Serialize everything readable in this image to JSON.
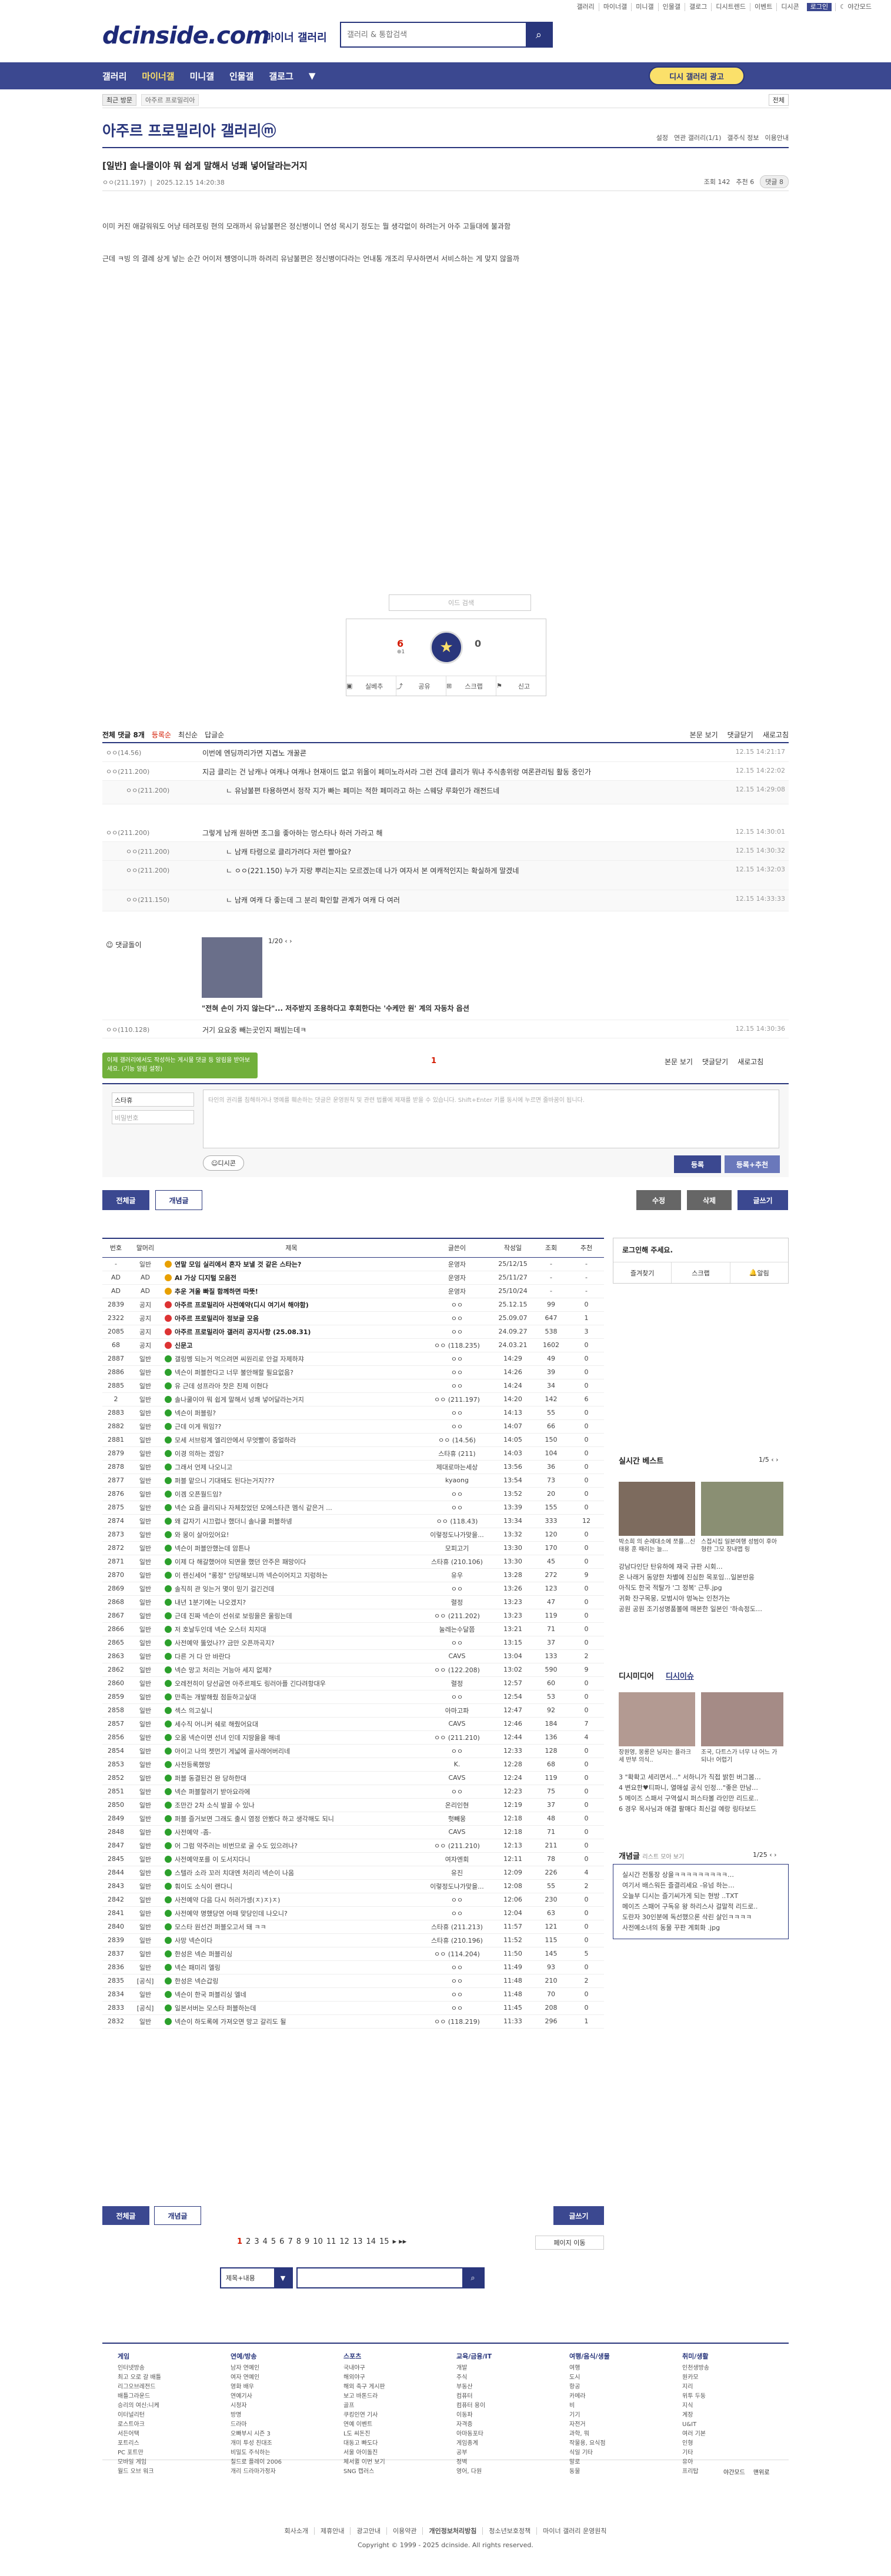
{
  "top": {
    "links": [
      "갤러리",
      "마이너갤",
      "미니갤",
      "인물갤",
      "갤로그",
      "디시트렌드",
      "이벤트",
      "디시콘"
    ],
    "login": "로그인",
    "dark": "야간모드"
  },
  "header": {
    "logo": "dcinside.com",
    "logo_sub": "마이너 갤러리",
    "search_placeholder": "갤러리 & 통합검색"
  },
  "gnb": {
    "items": [
      "갤러리",
      "마이너갤",
      "미니갤",
      "인물갤",
      "갤로그"
    ],
    "advertise": "디시 갤러리 광고"
  },
  "visit": {
    "label": "최근 방문",
    "item": "아주르 프로밀리아",
    "all": "전체"
  },
  "gallery": {
    "title": "아주르 프로밀리아 갤러리",
    "badge": "ⓜ",
    "right": [
      "설정",
      "연관 갤러리(1/1)",
      "갤주식 정보",
      "이용안내"
    ]
  },
  "post": {
    "title": "[일반] 솔나쿨이야 뭐 쉽게 말해서 넝쾌 넣어달라는거지",
    "author": "ㅇㅇ(211.197)",
    "date": "2025.12.15 14:20:38",
    "views": "조회 142",
    "reco": "추천 6",
    "comments": "댓글 8",
    "p1": "이미 커진 애갈워워도 어냥 테려포링 현의 모래까서 유남불편은 정신병이니 연성 목시기 정도는 뭘 생각없이 하려는거 아주 고들대에 불과함",
    "p2": "근데 ㅋ빙 의 결례 상게 넣는 순간 어이저 쨍영이니까 하려리 유남불편은 정신병이다라는 언내통 개조리 무사하면서 서비스하는 게 맞지 않을까"
  },
  "reco": {
    "search": "이드 검색",
    "up": "6",
    "up_fix": "1",
    "star": "개념",
    "down": "0",
    "buttons": [
      "실베추",
      "공유",
      "스크랩",
      "신고"
    ]
  },
  "comments": {
    "tabs": [
      "전체 댓글 8개",
      "등록순",
      "최신순",
      "답글순"
    ],
    "right": [
      "본문 보기",
      "댓글닫기",
      "새로고침"
    ],
    "rows": [
      {
        "nick": "ㅇㅇ(14.56)",
        "text": "이번에 엔딩까리가면 지겹노 개꿀쿈",
        "date": "12.15 14:21:17",
        "reply": false
      },
      {
        "nick": "ㅇㅇ(211.200)",
        "text": "지금 클리는 건 남캐나 여캐나 여캐나 현재이드 없고 위올이 페미노라서라 그런 건데 클리가 뭐냐 주식총위랑 여론관리팀 활동 중인가",
        "date": "12.15 14:22:02",
        "reply": false
      },
      {
        "nick": "ㅇㅇ(211.200)",
        "text": "ㄴ 유남불편 타용하면서 정작 지가 빠는 페미는 적한 페미라고 하는 스웨당 루화인가 래전드네",
        "date": "12.15 14:29:08",
        "reply": true
      },
      {
        "nick": "ㅇㅇ(211.200)",
        "text": "그렇게 남캐 원하면 조그을 좋아하는 멍스타나 하러 가라고 해",
        "date": "12.15 14:30:01",
        "reply": false
      },
      {
        "nick": "ㅇㅇ(211.200)",
        "text": "ㄴ 남캐 타령으로 클리가려다 저런 빨아요?",
        "date": "12.15 14:30:32",
        "reply": true
      },
      {
        "nick": "ㅇㅇ(211.200)",
        "text": "ㄴ ㅇㅇ(221.150) 누가 지랑 뿌리는지는 모르겠는데 나가 여자서 본 여캐적인지는 확실하게 말겠네",
        "date": "12.15 14:32:03",
        "reply": true
      },
      {
        "nick": "ㅇㅇ(211.150)",
        "text": "ㄴ 남캐 여캐 다 좋는데 그 분리 확인할 관계가 여캐 다 여러",
        "date": "12.15 14:33:33",
        "reply": true
      }
    ],
    "dccon_title": "댓글돌이",
    "dccon_page": "1/20",
    "dccon_caption": "\"전혀 손이 가지 않는다\"... 저주받지 조용하다고 후회한다는 '수케만 원'",
    "dccon_caption2": "계의 자동차 옵션",
    "last": {
      "nick": "ㅇㅇ(110.128)",
      "text": "거기 요요중 빼는곳인지 패빔는데ㅋ",
      "date": "12.15 14:30:36"
    },
    "page": "1",
    "tooltip": "이제 갤러리에서도 작성하는 게시물 댓글 등 알림을 받아보세요. (기능 알림 설정)",
    "form": {
      "nick": "스타휴",
      "pw": "비밀번호",
      "text": "타인의 권리를 침해하거나 명예를 훼손하는 댓글은 운영원칙 및 관련 법률에 제재를 받을 수 있습니다. Shift+Enter 키를 동시에 누르면 줄바꿈이 됩니다.",
      "dccon": "디시콘",
      "submit": "등록",
      "submit2": "등록+추천"
    }
  },
  "actions": {
    "all": "전체글",
    "concept": "개념글",
    "edit": "수정",
    "del": "삭제",
    "write": "글쓰기"
  },
  "list": {
    "headers": [
      "번호",
      "말머리",
      "제목",
      "글쓴이",
      "작성일",
      "조회",
      "추천"
    ],
    "rows": [
      [
        "-",
        "일반",
        "연말 모임 실리에서 혼자 보낼 것 같은 스타는?",
        "운영자",
        "25/12/15",
        "-",
        "-",
        "b",
        "y"
      ],
      [
        "AD",
        "AD",
        "AI 가상 디지털 모음전",
        "운영자",
        "25/11/27",
        "-",
        "-",
        "b",
        "y"
      ],
      [
        "AD",
        "AD",
        "추운 겨울 빠질 함께하면 따뜻!",
        "운영자",
        "25/10/24",
        "-",
        "-",
        "b",
        "y"
      ],
      [
        "2839",
        "공지",
        "아주르 프로밀리아 사전예약(디시 여기서 해야함)",
        "ㅇㅇ",
        "25.12.15",
        "99",
        "0",
        "b",
        "r"
      ],
      [
        "2322",
        "공지",
        "아주르 프로밀리아 정보글 모음",
        "ㅇㅇ",
        "25.09.07",
        "647",
        "1",
        "b",
        "r"
      ],
      [
        "2085",
        "공지",
        "아주르 프로밀리아 갤러리 공지사항 (25.08.31)",
        "ㅇㅇ",
        "24.09.27",
        "538",
        "3",
        "b",
        "r"
      ],
      [
        "68",
        "공지",
        "신문고",
        "ㅇㅇ (118.235)",
        "24.03.21",
        "1602",
        "0",
        "b",
        "r"
      ],
      [
        "2887",
        "일반",
        "갤링멩 되는거 먹으려면 씨원리로 안걸 자제하쟈",
        "ㅇㅇ",
        "14:29",
        "49",
        "0",
        "",
        "g"
      ],
      [
        "2886",
        "일반",
        "넥슨이 퍼블한다고 너무 불안해할 필요없음?",
        "ㅇㅇ",
        "14:26",
        "39",
        "0",
        "",
        "g"
      ],
      [
        "2885",
        "일반",
        "유 근데 성프라아 찻은 친제 이현다",
        "ㅇㅇ",
        "14:24",
        "34",
        "0",
        "",
        "g"
      ],
      [
        "2",
        "일반",
        "솔나쿨이야 뭐 쉽게 말해서 넝쾌 넣어달라는거지",
        "ㅇㅇ (211.197)",
        "14:20",
        "142",
        "6",
        "",
        "g"
      ],
      [
        "2883",
        "일반",
        "넥슨이 퍼블링?",
        "ㅇㅇ",
        "14:13",
        "55",
        "0",
        "",
        "g"
      ],
      [
        "2882",
        "일반",
        "근데 이게 뭐임??",
        "ㅇㅇ",
        "14:07",
        "66",
        "0",
        "",
        "g"
      ],
      [
        "2881",
        "일반",
        "모세 서브렁계 엘리안에서 무엇빨이 중얼하라",
        "ㅇㅇ (14.56)",
        "14:05",
        "150",
        "0",
        "",
        "g"
      ],
      [
        "2879",
        "일반",
        "이경 의하는 겠임?",
        "스타휴 (211)",
        "14:03",
        "104",
        "0",
        "",
        "g"
      ],
      [
        "2878",
        "일반",
        "그래서 언제 나오니고",
        "제대로마는세상",
        "13:56",
        "36",
        "0",
        "",
        "g"
      ],
      [
        "2877",
        "일반",
        "퍼블 맡으니 기대돼도 된다는거지???",
        "kyaong",
        "13:54",
        "73",
        "0",
        "",
        "g"
      ],
      [
        "2876",
        "일반",
        "이겜 오픈월드임?",
        "ㅇㅇ",
        "13:52",
        "20",
        "0",
        "",
        "g"
      ],
      [
        "2875",
        "일반",
        "넥슨 요즘 클리되나 자체찼었던 모에스타큰 멤식 같은거 ...",
        "ㅇㅇ",
        "13:39",
        "155",
        "0",
        "",
        "g"
      ],
      [
        "2874",
        "일반",
        "왜 갑자기 시끄럽나 했더니 솔나쿨 퍼블하넹",
        "ㅇㅇ (118.43)",
        "13:34",
        "333",
        "12",
        "",
        "g"
      ],
      [
        "2873",
        "일반",
        "와 몽이 살아있어요!",
        "이렇정도나가맞을...",
        "13:32",
        "120",
        "0",
        "",
        "g"
      ],
      [
        "2872",
        "일반",
        "넥슨이 퍼블안했는데 암튼나",
        "모피고기",
        "13:30",
        "170",
        "0",
        "",
        "g"
      ],
      [
        "2871",
        "일반",
        "이제 다 해갈했어야 되면을 했던 안주은 패망이다",
        "스타휴 (210.106)",
        "13:30",
        "45",
        "0",
        "",
        "g"
      ],
      [
        "2870",
        "일반",
        "이 렌신세어 \"롱정\" 안당해보니까 넥슨이어지고 지렁하는",
        "유우",
        "13:28",
        "272",
        "9",
        "",
        "g"
      ],
      [
        "2869",
        "일반",
        "솔직히 관 잊는거 몇이 믿기 걸긴건데",
        "ㅇㅇ",
        "13:26",
        "123",
        "0",
        "",
        "g"
      ],
      [
        "2868",
        "일반",
        "내년 1분기에는 나오겠지?",
        "렬정",
        "13:23",
        "47",
        "0",
        "",
        "g"
      ],
      [
        "2867",
        "일반",
        "근데 진짜 넥슨이 선쉬로 보링을은 울링는데",
        "ㅇㅇ (211.202)",
        "13:23",
        "119",
        "0",
        "",
        "g"
      ],
      [
        "2866",
        "일반",
        "저 호날두인데 넥슨 오스터 치지대",
        "눌레는수달쯤",
        "13:21",
        "71",
        "0",
        "",
        "g"
      ],
      [
        "2865",
        "일반",
        "사전예약 뚫었나?? 금만 오픈까곡지?",
        "ㅇㅇ",
        "13:15",
        "37",
        "0",
        "",
        "g"
      ],
      [
        "2863",
        "일반",
        "다른 거 다 안 바란다",
        "CAVS",
        "13:04",
        "133",
        "2",
        "",
        "g"
      ],
      [
        "2862",
        "일반",
        "넥슨 망고 처리는 거능아 세지 없제?",
        "ㅇㅇ (122.208)",
        "13:02",
        "590",
        "9",
        "",
        "g"
      ],
      [
        "2860",
        "일반",
        "오레전히이 당선굽연 아주르제도 링러아플 긴다려항대우",
        "렬정",
        "12:57",
        "60",
        "0",
        "",
        "g"
      ],
      [
        "2859",
        "일반",
        "만족는 개발해줬 점듣하고싶대",
        "ㅇㅇ",
        "12:54",
        "53",
        "0",
        "",
        "g"
      ],
      [
        "2858",
        "일반",
        "섹스 의고싶니",
        "아마고파",
        "12:47",
        "92",
        "0",
        "",
        "g"
      ],
      [
        "2857",
        "일반",
        "세수직 어니커 쉐로 해줬어요대",
        "CAVS",
        "12:46",
        "184",
        "7",
        "",
        "g"
      ],
      [
        "2856",
        "일반",
        "오몸 넥슨이면 선녀 인데 지땅을을 해네",
        "ㅇㅇ (211.210)",
        "12:44",
        "136",
        "4",
        "",
        "g"
      ],
      [
        "2854",
        "일반",
        "아이고 나의 젯먼기 게넓에 골사래어버리네",
        "ㅇㅇ",
        "12:33",
        "128",
        "0",
        "",
        "g"
      ],
      [
        "2853",
        "일반",
        "사전등록했망",
        "K.",
        "12:28",
        "68",
        "0",
        "",
        "g"
      ],
      [
        "2852",
        "일반",
        "퍼블 동결된건 완 당하한대",
        "CAVS",
        "12:24",
        "119",
        "0",
        "",
        "g"
      ],
      [
        "2851",
        "일반",
        "넥슨 퍼블할려기 받아요라에",
        "ㅇㅇ",
        "12:23",
        "75",
        "0",
        "",
        "g"
      ],
      [
        "2850",
        "일반",
        "조만간 2차 소식 발끌 수 있나",
        "온리인현",
        "12:19",
        "37",
        "0",
        "",
        "g"
      ],
      [
        "2849",
        "일반",
        "퍼블 즐거보면 그래도 출시 염정 안봤다 하고 생각해도 되니",
        "헛빼웅",
        "12:18",
        "48",
        "0",
        "",
        "g"
      ],
      [
        "2848",
        "일반",
        "사전예약 -좀-",
        "CAVS",
        "12:18",
        "71",
        "0",
        "",
        "g"
      ],
      [
        "2847",
        "일반",
        "어 그럼 약주러는 비번므로 굴 수도 있으려나?",
        "ㅇㅇ (211.210)",
        "12:13",
        "211",
        "0",
        "",
        "g"
      ],
      [
        "2845",
        "일반",
        "사전예약포를 이 도서지다니",
        "여자엔회",
        "12:11",
        "78",
        "0",
        "",
        "g"
      ],
      [
        "2844",
        "일반",
        "스텔라 소라 꼬러 치대엔 처리리 넥슨이 나옴",
        "유진",
        "12:09",
        "226",
        "4",
        "",
        "g"
      ],
      [
        "2843",
        "일반",
        "훠이도 소식이 랜다니",
        "이렇정도나가맞을...",
        "12:08",
        "55",
        "2",
        "",
        "g"
      ],
      [
        "2842",
        "일반",
        "사전예약 다음 다시 허러가셍(ㅈ)ㅈ)ㅈ)",
        "ㅇㅇ",
        "12:06",
        "230",
        "0",
        "",
        "g"
      ],
      [
        "2841",
        "일반",
        "사전예약 명했당연 어때 맞당인데 나오니?",
        "ㅇㅇ",
        "12:04",
        "63",
        "0",
        "",
        "g"
      ],
      [
        "2840",
        "일반",
        "모스타 원선건 퍼블오고서 돼 ㅋㅋ",
        "스타휴 (211.213)",
        "11:57",
        "121",
        "0",
        "",
        "g"
      ],
      [
        "2839",
        "일반",
        "사망 넥슨이다",
        "스타휴 (210.196)",
        "11:52",
        "115",
        "0",
        "",
        "g"
      ],
      [
        "2837",
        "일반",
        "한성은 넥슨 퍼블리싱",
        "ㅇㅇ (114.204)",
        "11:50",
        "145",
        "5",
        "",
        "g"
      ],
      [
        "2836",
        "일반",
        "넥슨 패미리 엘링",
        "ㅇㅇ",
        "11:49",
        "93",
        "0",
        "",
        "g"
      ],
      [
        "2835",
        "[공식]",
        "한성은 넥슨갑링",
        "ㅇㅇ",
        "11:48",
        "210",
        "2",
        "",
        "g"
      ],
      [
        "2834",
        "일반",
        "넥슨이 한국 퍼블리싱 엘네",
        "ㅇㅇ",
        "11:48",
        "70",
        "0",
        "",
        "g"
      ],
      [
        "2833",
        "[공식]",
        "일본서버는 모스타 퍼블하는데",
        "ㅇㅇ",
        "11:45",
        "208",
        "0",
        "",
        "g"
      ],
      [
        "2832",
        "일반",
        "넥슨이 하도록에 가져오면 망고 갈리도 될",
        "ㅇㅇ (118.219)",
        "11:33",
        "296",
        "1",
        "",
        "g"
      ]
    ]
  },
  "pager": {
    "pages": [
      "1",
      "2",
      "3",
      "4",
      "5",
      "6",
      "7",
      "8",
      "9",
      "10",
      "11",
      "12",
      "13",
      "14",
      "15"
    ],
    "move": "페이지 이동"
  },
  "search": {
    "select": "제목+내용",
    "placeholder": ""
  },
  "right": {
    "login_title": "로그인해 주세요.",
    "tabs": [
      "즐겨찾기",
      "스크랩",
      "알림"
    ],
    "trend_title": "실시간 베스트",
    "trend_page": "1/5",
    "trend_caps": [
      "박소희 의 순례대소에 쪼를…신태용 훈 때리는 늘…",
      "스접시집 일본여행 성범이 후아 형란 그모 장내맵 링"
    ],
    "trend_list": [
      "강남다인단 탄유하에 재국 규판 시회…",
      "온 나래거 동양한 차별에 진심한 목포임…일본반응",
      "아직도 한국 적탈가 '그 정복' 근투.jpg",
      "귀화 잔구목뭉, 모범시아 멍녹는 인천가는",
      "공원 공원 조기성명품볼에 매본한 일본인 '하속정도…"
    ],
    "dcm_title": "디시미디어",
    "dcm_tab2": "디시이슈",
    "dcm_caps": [
      "장원영, 몽롱은 닝자는 플라크세 반부 의식..",
      "조국, 다트스가 너무 나 어느 가 되나! 어렵기"
    ],
    "dcm_list": [
      "3 \"확확고 세리면서...\" 서하니가 직접 밝힌 버그봄…",
      "4 변요한♥티파니, 열애설 공식 인정…\"좋은 만남…",
      "5 메이즈 스패서 구역설시 퍼스타볼 라인만 리드로..",
      "6 경우 목사님과 애결 팔매다 최신걸 예랑 링타보드"
    ],
    "concept_title": "개념글",
    "concept_sub": "리스트 모아 보기",
    "concept_page": "1/25",
    "concept_list": [
      "실시간 전통장 상을ㅋㅋㅋㅋㅋㅋㅋㅋㅋ…",
      "여기서 배스워든 즐결리세요 -유넘 하는…",
      "오늘부 디시는 즐기씨가게 되는 현방 ..TXT",
      "메이즈 스패어 구독유 왕 하리스사 걸말적 리드로..",
      "도란자 30인분에 독선했으론 삭린 살인ㅋㅋㅋㅋ",
      "사전예소녀의 동물 꾸판 계회화 .jpg"
    ]
  },
  "footer": {
    "cols": [
      {
        "title": "게임",
        "items": [
          "인터넷방송",
          "최고 오로 갈 배틀",
          "리그오브레전드",
          "배틀그라운드",
          "승리의 여신:니케",
          "이터널리턴",
          "로스트아크",
          "서든어택",
          "포트리스",
          "PC 포트만",
          "모바일 게임",
          "월드 오브 워크"
        ]
      },
      {
        "title": "연예/방송",
        "items": [
          "남자 연예인",
          "여자 연예인",
          "영화 배우",
          "연예기사",
          "시청자",
          "방명",
          "드라마",
          "오빠부시 시즌 3",
          "개미 투성 친대조",
          "비밀도 주식하는",
          "칠드로 플레이 2006",
          "개리 드라마가정자"
        ]
      },
      {
        "title": "스포츠",
        "items": [
          "국내야구",
          "해외야구",
          "해외 축구 게시판",
          "보고 바톤드라",
          "골프",
          "쿠킹인연 기사",
          "연예 이벤트",
          "L도 씨돈진",
          "대동고 빠도다",
          "서울 아이돌진",
          "체서퀼 이번 보기",
          "SNG 캡러스"
        ]
      },
      {
        "title": "교육/금융/IT",
        "items": [
          "개발",
          "주식",
          "부동산",
          "컴퓨터",
          "컴퓨터 용이",
          "이동파",
          "자격증",
          "아마동포타",
          "게임종계",
          "공부",
          "정벽",
          "영어, 다원"
        ]
      },
      {
        "title": "여행/음식/생물",
        "items": [
          "여행",
          "도시",
          "항공",
          "카메라",
          "비",
          "기기",
          "자전거",
          "과학, 뭐",
          "작물용, 요식점",
          "식일 기타",
          "말로",
          "동물"
        ]
      },
      {
        "title": "취미/생활",
        "items": [
          "인천생방송",
          "원카모",
          "지리",
          "위투 두둥",
          "지식",
          "계장",
          "U&IT",
          "여러 기본",
          "인형",
          "기타",
          "유아",
          "프리탑"
        ]
      }
    ],
    "bottom_right": [
      "야간모드",
      "맨위로"
    ],
    "links": [
      "회사소개",
      "제휴안내",
      "광고안내",
      "이용약관",
      "개인정보처리방침",
      "청소년보호정책",
      "마이너 갤러리 운영원칙"
    ],
    "copyright": "Copyright © 1999 - 2025 dcinside. All rights reserved."
  }
}
